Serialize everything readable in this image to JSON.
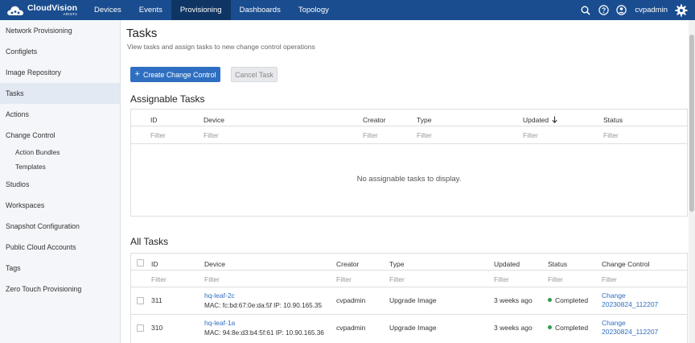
{
  "brand": {
    "name": "CloudVision",
    "sub": "ARISTA"
  },
  "nav": [
    {
      "label": "Devices"
    },
    {
      "label": "Events"
    },
    {
      "label": "Provisioning",
      "active": true
    },
    {
      "label": "Dashboards"
    },
    {
      "label": "Topology"
    }
  ],
  "header": {
    "user": "cvpadmin",
    "icons": [
      "search-icon",
      "help-icon",
      "user-icon",
      "gear-icon"
    ]
  },
  "sidebar": {
    "items": [
      {
        "label": "Network Provisioning"
      },
      {
        "label": "Configlets"
      },
      {
        "label": "Image Repository"
      },
      {
        "label": "Tasks",
        "active": true
      },
      {
        "label": "Actions"
      },
      {
        "label": "Change Control"
      },
      {
        "label": "Action Bundles",
        "sub": true
      },
      {
        "label": "Templates",
        "sub": true
      },
      {
        "label": "Studios"
      },
      {
        "label": "Workspaces"
      },
      {
        "label": "Snapshot Configuration"
      },
      {
        "label": "Public Cloud Accounts"
      },
      {
        "label": "Tags"
      },
      {
        "label": "Zero Touch Provisioning"
      }
    ]
  },
  "page": {
    "title": "Tasks",
    "subtitle": "View tasks and assign tasks to new change control operations",
    "create_button": "Create Change Control",
    "cancel_button": "Cancel Task"
  },
  "assignable": {
    "title": "Assignable Tasks",
    "columns": [
      "ID",
      "Device",
      "Creator",
      "Type",
      "Updated",
      "Status"
    ],
    "filter_placeholder": "Filter",
    "empty_message": "No assignable tasks to display."
  },
  "all_tasks": {
    "title": "All Tasks",
    "columns": [
      "ID",
      "Device",
      "Creator",
      "Type",
      "Updated",
      "Status",
      "Change Control"
    ],
    "filter_placeholder": "Filter",
    "rows": [
      {
        "id": "311",
        "device_name": "hq-leaf-2c",
        "device_info": "MAC: fc:bd:67:0e:da:5f IP: 10.90.165.35",
        "creator": "cvpadmin",
        "type": "Upgrade Image",
        "updated": "3 weeks ago",
        "status": "Completed",
        "cc_line1": "Change",
        "cc_line2": "20230824_112207"
      },
      {
        "id": "310",
        "device_name": "hq-leaf-1a",
        "device_info": "MAC: 94:8e:d3:b4:5f:61 IP: 10.90.165.36",
        "creator": "cvpadmin",
        "type": "Upgrade Image",
        "updated": "3 weeks ago",
        "status": "Completed",
        "cc_line1": "Change",
        "cc_line2": "20230824_112207"
      }
    ]
  },
  "colors": {
    "topbar": "#1a4d8f",
    "accent": "#2f6fc1",
    "status_ok": "#2e9e4f"
  }
}
